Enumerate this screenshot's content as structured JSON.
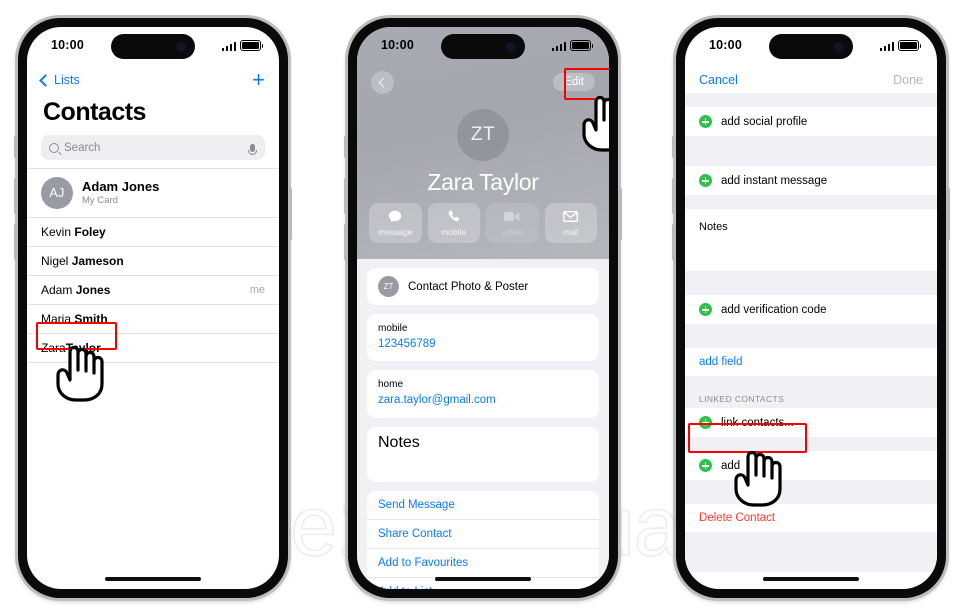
{
  "watermark": "iphone16manual.com",
  "colors": {
    "ios_blue": "#0a7bff",
    "highlight_red": "#f40000",
    "green_plus": "#2ec24a",
    "delete_red": "#ff3b30",
    "group_bg": "#f1f1f5"
  },
  "phone1": {
    "status": {
      "time": "10:00",
      "signal_icon": "cellular-bars-icon",
      "battery_icon": "battery-icon"
    },
    "nav": {
      "back_label": "Lists",
      "back_icon": "chevron-left-icon",
      "add_label": "+",
      "add_icon": "plus-icon"
    },
    "title": "Contacts",
    "search": {
      "placeholder": "Search",
      "icon": "search-icon",
      "mic_icon": "microphone-icon"
    },
    "my_card": {
      "initials": "AJ",
      "name": "Adam Jones",
      "subtitle": "My Card"
    },
    "contacts": [
      {
        "first": "Kevin ",
        "last": "Foley",
        "tag": ""
      },
      {
        "first": "Nigel ",
        "last": "Jameson",
        "tag": ""
      },
      {
        "first": "Adam ",
        "last": "Jones",
        "tag": "me"
      },
      {
        "first": "Maria ",
        "last": "Smith",
        "tag": ""
      },
      {
        "first": "Zara",
        "last": "Taylor",
        "tag": ""
      }
    ],
    "highlighted_contact_index": 4,
    "cursor": "pointing-hand-cursor"
  },
  "phone2": {
    "status": {
      "time": "10:00",
      "signal_icon": "cellular-bars-icon",
      "battery_icon": "battery-icon"
    },
    "nav": {
      "back_icon": "chevron-left-icon",
      "edit_label": "Edit"
    },
    "avatar_initials": "ZT",
    "contact_name": "Zara Taylor",
    "actions": [
      {
        "label": "message",
        "icon": "message-bubble-icon",
        "disabled": false
      },
      {
        "label": "mobile",
        "icon": "phone-handset-icon",
        "disabled": false
      },
      {
        "label": "video",
        "icon": "video-camera-icon",
        "disabled": true
      },
      {
        "label": "mail",
        "icon": "envelope-icon",
        "disabled": false
      }
    ],
    "photo_poster": {
      "initials": "ZT",
      "label": "Contact Photo & Poster"
    },
    "fields": [
      {
        "key": "mobile",
        "value": "123456789"
      },
      {
        "key": "home",
        "value": "zara.taylor@gmail.com"
      }
    ],
    "notes_label": "Notes",
    "links": [
      "Send Message",
      "Share Contact",
      "Add to Favourites",
      "Add to List"
    ],
    "cursor": "pointing-hand-cursor"
  },
  "phone3": {
    "status": {
      "time": "10:00",
      "signal_icon": "cellular-bars-icon",
      "battery_icon": "battery-icon"
    },
    "nav": {
      "cancel_label": "Cancel",
      "done_label": "Done"
    },
    "rows": [
      {
        "label": "add social profile",
        "icon": "plus-circle-green-icon"
      },
      {
        "label": "add instant message",
        "icon": "plus-circle-green-icon"
      }
    ],
    "notes_label": "Notes",
    "verification_row": {
      "label": "add verification code",
      "icon": "plus-circle-green-icon"
    },
    "add_field_label": "add field",
    "linked_section_header": "LINKED CONTACTS",
    "link_contacts_row": {
      "label": "link contacts...",
      "icon": "plus-circle-green-icon"
    },
    "obscured_row": {
      "label": "add",
      "icon": "plus-circle-green-icon"
    },
    "delete_label": "Delete Contact",
    "cursor": "pointing-hand-cursor"
  }
}
